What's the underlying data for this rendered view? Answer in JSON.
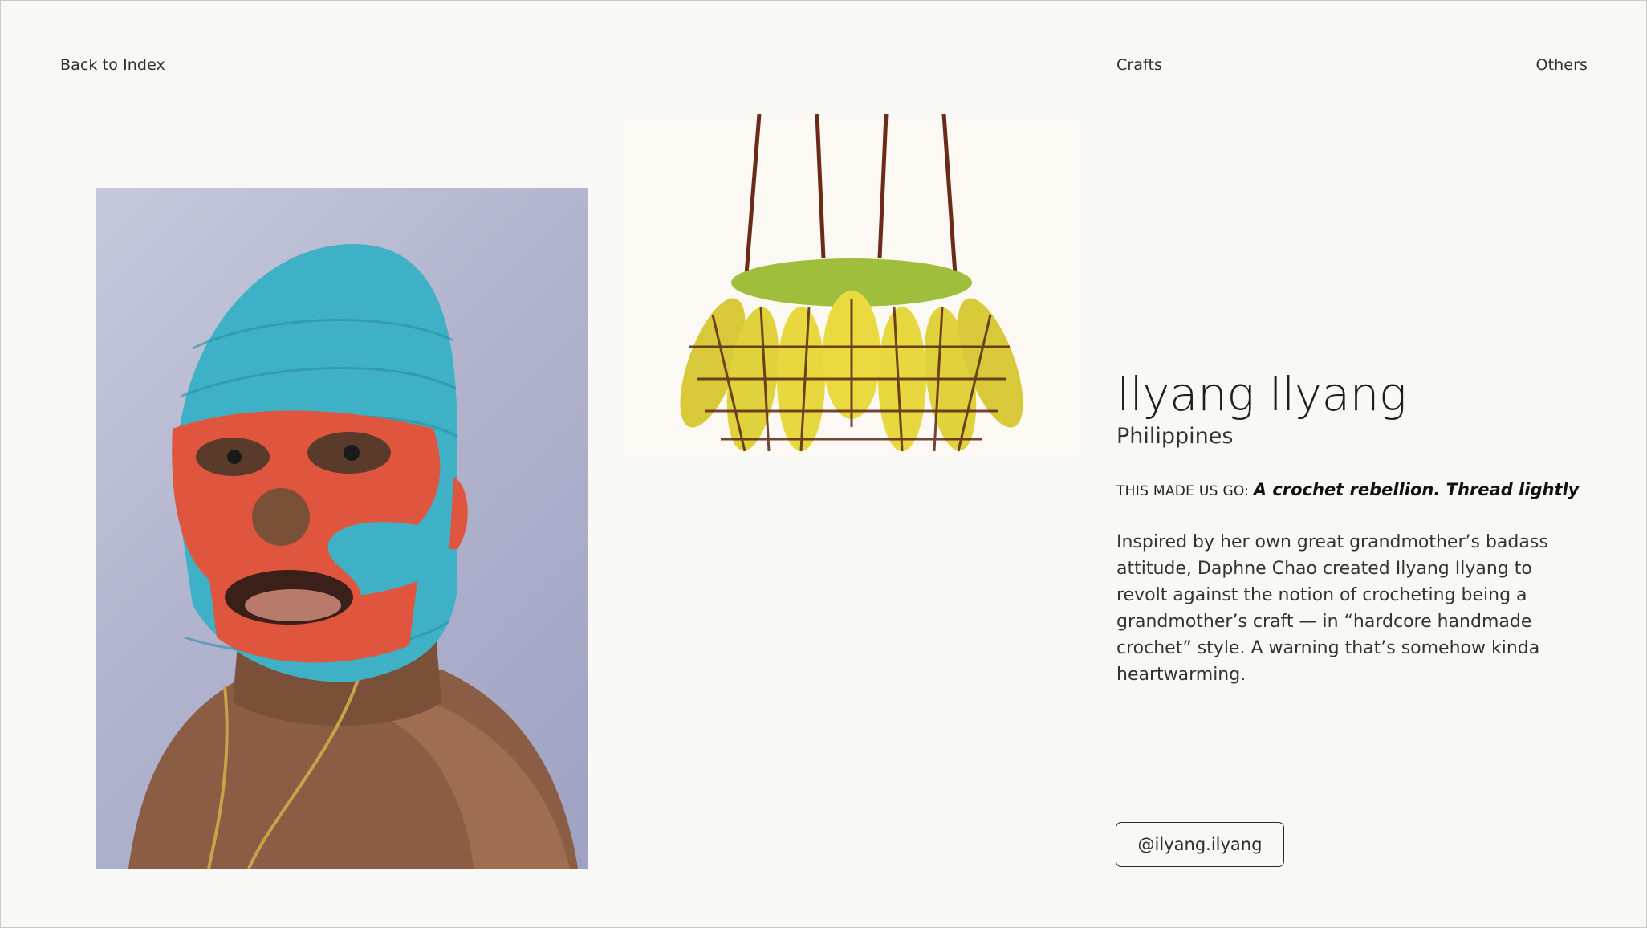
{
  "nav": {
    "back_label": "Back to Index",
    "crafts_label": "Crafts",
    "others_label": "Others"
  },
  "images": {
    "mask_photo": "crochet-mask-portrait",
    "bag_photo": "crochet-banana-bag"
  },
  "profile": {
    "title": "Ilyang Ilyang",
    "country": "Philippines",
    "tagline_label": "THIS MADE US GO:",
    "tagline": "A crochet rebellion. Thread lightly",
    "description": "Inspired by her own great grandmother’s badass attitude, Daphne Chao created Ilyang Ilyang to revolt against the notion of crocheting being a grandmother’s craft — in “hardcore handmade crochet” style. A warning that’s somehow kinda heartwarming.",
    "handle": "@ilyang.ilyang"
  },
  "colors": {
    "background": "#f8f8f6",
    "text": "#2a2a2a",
    "mask_blue": "#3fb1c6",
    "mask_red": "#e0553d"
  }
}
